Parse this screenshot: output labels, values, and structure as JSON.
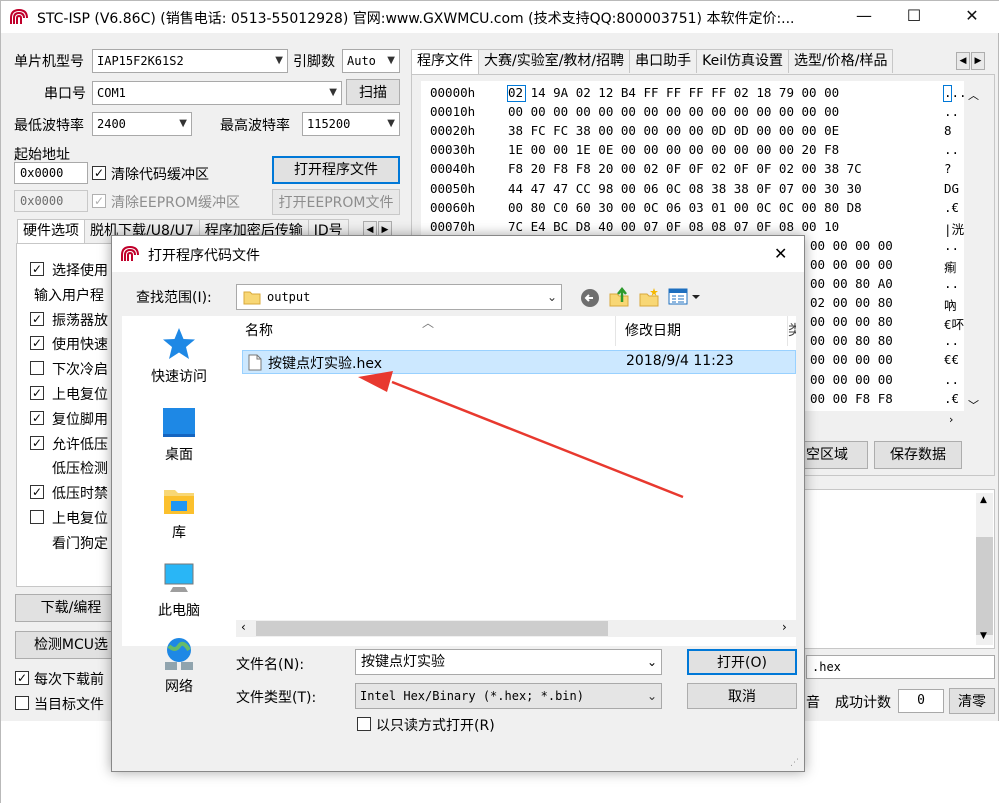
{
  "app": {
    "title": "STC-ISP (V6.86C) (销售电话: 0513-55012928) 官网:www.GXWMCU.com  (技术支持QQ:800003751) 本软件定价:...",
    "window_min": "—",
    "window_max": "☐",
    "window_close": "✕"
  },
  "left": {
    "mcu_label": "单片机型号",
    "mcu_value": "IAP15F2K61S2",
    "pins_label": "引脚数",
    "pins_value": "Auto",
    "port_label": "串口号",
    "port_value": "COM1",
    "scan_button": "扫描",
    "min_baud_label": "最低波特率",
    "min_baud_value": "2400",
    "max_baud_label": "最高波特率",
    "max_baud_value": "115200",
    "start_addr_label": "起始地址",
    "code_addr": "0x0000",
    "clear_code_buffer": "清除代码缓冲区",
    "open_program_button": "打开程序文件",
    "eeprom_addr": "0x0000",
    "clear_eeprom_buffer": "清除EEPROM缓冲区",
    "open_eeprom_button": "打开EEPROM文件",
    "hw_tabs": [
      "硬件选项",
      "脱机下载/U8/U7",
      "程序加密后传输",
      "ID号"
    ],
    "hw_options": [
      {
        "label": "选择使用",
        "checked": true,
        "indent": false
      },
      {
        "label": "输入用户程",
        "checked": null,
        "indent": false
      },
      {
        "label": "振荡器放",
        "checked": true,
        "indent": false
      },
      {
        "label": "使用快速",
        "checked": true,
        "indent": false
      },
      {
        "label": "下次冷启",
        "checked": false,
        "indent": false
      },
      {
        "label": "上电复位",
        "checked": true,
        "indent": false
      },
      {
        "label": "复位脚用",
        "checked": true,
        "indent": false
      },
      {
        "label": "允许低压",
        "checked": true,
        "indent": false
      },
      {
        "label": "低压检测",
        "checked": null,
        "indent": true
      },
      {
        "label": "低压时禁",
        "checked": true,
        "indent": false
      },
      {
        "label": "上电复位",
        "checked": false,
        "indent": false
      },
      {
        "label": "看门狗定",
        "checked": null,
        "indent": true
      }
    ],
    "download_button": "下载/编程",
    "detect_button": "检测MCU选",
    "every_download": "每次下载前",
    "when_file": "当目标文件"
  },
  "right": {
    "tabs": [
      "程序文件",
      "大赛/实验室/教材/招聘",
      "串口助手",
      "Keil仿真设置",
      "选型/价格/样品"
    ],
    "hex_rows": [
      {
        "addr": "00000h",
        "bytes": "02 14 9A 02 12 B4 FF FF FF FF 02 18 79 00 00",
        "ascii": "..."
      },
      {
        "addr": "00010h",
        "bytes": "00 00 00 00 00 00 00 00 00 00 00 00 00 00 00",
        "ascii": ".."
      },
      {
        "addr": "00020h",
        "bytes": "38 FC FC 38 00 00 00 00 00 0D 0D 00 00 00 0E",
        "ascii": "8"
      },
      {
        "addr": "00030h",
        "bytes": "1E 00 00 1E 0E 00 00 00 00 00 00 00 00 20 F8",
        "ascii": ".."
      },
      {
        "addr": "00040h",
        "bytes": "F8 20 F8 F8 20 00 02 0F 0F 02 0F 0F 02 00 38 7C",
        "ascii": "?"
      },
      {
        "addr": "00050h",
        "bytes": "44 47 47 CC 98 00 06 0C 08 38 38 0F 07 00 30 30",
        "ascii": "DG"
      },
      {
        "addr": "00060h",
        "bytes": "00 80 C0 60 30 00 0C 06 03 01 00 0C 0C 00 80 D8",
        "ascii": ".€"
      },
      {
        "addr": "00070h",
        "bytes": "7C E4 BC D8 40 00 07 0F 08 08 07 0F 08 00 10",
        "ascii": "|洸"
      },
      {
        "addr": "",
        "bytes": "00 00 00 00",
        "ascii": ".."
      },
      {
        "addr": "",
        "bytes": "00 00 00 00",
        "ascii": "痸"
      },
      {
        "addr": "",
        "bytes": "00 00 80 A0",
        "ascii": ".."
      },
      {
        "addr": "",
        "bytes": "02 00 00 80",
        "ascii": "吶"
      },
      {
        "addr": "",
        "bytes": "00 00 00 80",
        "ascii": "€吥"
      },
      {
        "addr": "",
        "bytes": "00 00 80 80",
        "ascii": ".."
      },
      {
        "addr": "",
        "bytes": "00 00 00 00",
        "ascii": "€€"
      },
      {
        "addr": "",
        "bytes": "00 00 00 00",
        "ascii": ".."
      },
      {
        "addr": "",
        "bytes": "00 00 F8 F8",
        "ascii": ".€"
      }
    ],
    "clear_area_button": "空区域",
    "save_data_button": "保存数据",
    "file_path_tail": ".hex",
    "sound_label": "音",
    "success_count_label": "成功计数",
    "success_count_value": "0",
    "clear_count_button": "清零"
  },
  "dialog": {
    "title": "打开程序代码文件",
    "close": "✕",
    "look_in_label": "查找范围(I):",
    "look_in_value": "output",
    "places": [
      "快速访问",
      "桌面",
      "库",
      "此电脑",
      "网络"
    ],
    "col_name": "名称",
    "col_date": "修改日期",
    "files": [
      {
        "name": "按键点灯实验.hex",
        "date": "2018/9/4 11:23"
      }
    ],
    "filename_label": "文件名(N):",
    "filename_value": "按键点灯实验",
    "filetype_label": "文件类型(T):",
    "filetype_value": "Intel Hex/Binary (*.hex; *.bin)",
    "readonly_label": "以只读方式打开(R)",
    "open_button": "打开(O)",
    "cancel_button": "取消"
  },
  "colors": {
    "selection": "#cce8ff",
    "selection_border": "#99d1ff",
    "focus_blue": "#0078d7",
    "arrow_red": "#e8392f"
  }
}
